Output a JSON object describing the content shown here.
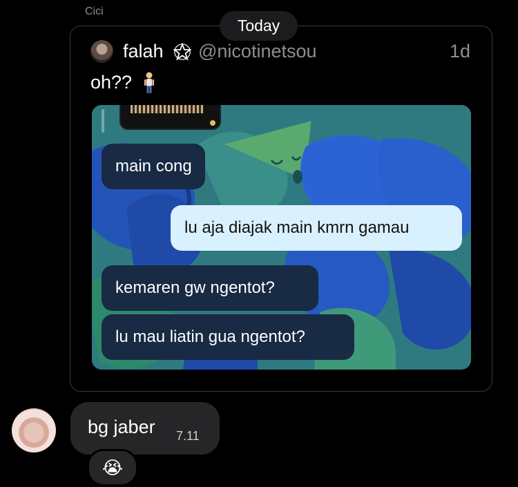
{
  "sender_name": "Cici",
  "date_divider": "Today",
  "quoted_tweet": {
    "author_name": "falah",
    "badge_icon": "pentagram-icon",
    "handle": "@nicotinetsou",
    "time": "1d",
    "text": "oh??",
    "emoji_icon": "person-standing-icon",
    "media": {
      "messages": [
        {
          "side": "in",
          "text": "main cong"
        },
        {
          "side": "out",
          "text": "lu aja diajak main kmrn gamau"
        },
        {
          "side": "in",
          "text": "kemaren gw ngentot?"
        },
        {
          "side": "in",
          "text": "lu mau liatin gua ngentot?"
        }
      ]
    }
  },
  "reply": {
    "text": "bg jaber",
    "time": "7.11",
    "reaction": "😭"
  },
  "colors": {
    "background": "#000000",
    "incoming_bubble": "#182a44",
    "outgoing_bubble": "#d9f0ff",
    "reply_bubble": "#262628",
    "muted_text": "#8e8e93"
  }
}
